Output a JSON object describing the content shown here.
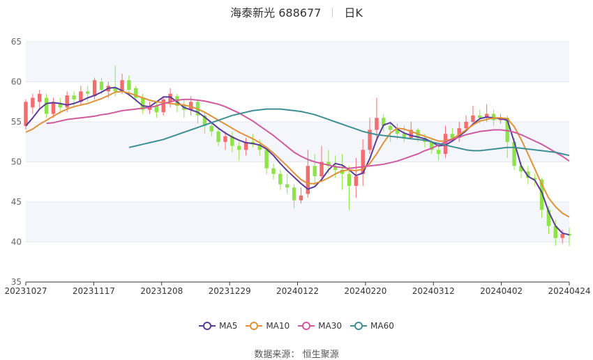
{
  "title": {
    "name": "海泰新光 688677",
    "period": "日K"
  },
  "source": {
    "label": "数据来源：",
    "value": "恒生聚源"
  },
  "colors": {
    "up": "#f26d6d",
    "down": "#8fe34a",
    "grid": "#e4e8f2",
    "band": "#f4f6fb"
  },
  "chart_data": {
    "type": "candlestick",
    "ylim": [
      35,
      65
    ],
    "yticks": [
      35,
      40,
      45,
      50,
      55,
      60,
      65
    ],
    "xticks": [
      "20231027",
      "20231117",
      "20231208",
      "20231229",
      "20240122",
      "20240220",
      "20240312",
      "20240402",
      "20240424"
    ],
    "legend_position": "bottom",
    "series": [
      {
        "name": "MA5",
        "color": "#5b3a99",
        "values": [
          54.5,
          55.5,
          56.6,
          57.3,
          57.4,
          57.3,
          57.1,
          57.3,
          57.6,
          58.0,
          58.3,
          58.7,
          59.2,
          59.3,
          58.9,
          58.4,
          57.7,
          57.0,
          56.9,
          57.5,
          58.1,
          58.1,
          57.5,
          56.8,
          56.5,
          56.2,
          55.6,
          54.9,
          54.2,
          53.6,
          53.1,
          52.7,
          52.4,
          52.3,
          52.1,
          51.6,
          50.8,
          49.8,
          48.9,
          48.1,
          47.3,
          46.6,
          46.9,
          47.8,
          49.0,
          49.8,
          49.6,
          49.0,
          48.3,
          48.6,
          50.4,
          52.8,
          54.6,
          54.9,
          54.1,
          53.6,
          53.3,
          53.1,
          52.9,
          52.5,
          52.0,
          52.1,
          52.6,
          53.2,
          53.9,
          54.7,
          55.4,
          55.6,
          55.5,
          55.4,
          55.2,
          52.5,
          49.5,
          48.2,
          47.7,
          46.2,
          43.8,
          42.0,
          41.1,
          40.9
        ]
      },
      {
        "name": "MA10",
        "color": "#e0913a",
        "values": [
          53.7,
          54.1,
          54.7,
          55.2,
          55.7,
          56.2,
          56.6,
          56.9,
          57.1,
          57.3,
          57.6,
          57.9,
          58.3,
          58.7,
          58.8,
          58.6,
          58.3,
          58.0,
          57.7,
          57.5,
          57.4,
          57.3,
          57.2,
          57.1,
          56.9,
          56.6,
          56.2,
          55.7,
          55.2,
          54.7,
          54.2,
          53.7,
          53.3,
          52.9,
          52.4,
          51.8,
          51.1,
          50.3,
          49.5,
          48.6,
          47.8,
          47.3,
          47.3,
          47.6,
          48.0,
          48.5,
          48.9,
          49.0,
          48.9,
          49.1,
          49.8,
          51.0,
          52.4,
          53.6,
          54.2,
          54.1,
          53.8,
          53.5,
          53.2,
          52.9,
          52.6,
          52.6,
          52.9,
          53.4,
          54.0,
          54.6,
          55.1,
          55.3,
          55.5,
          55.5,
          55.4,
          54.4,
          52.8,
          51.0,
          49.1,
          47.2,
          45.5,
          44.4,
          43.6,
          43.1
        ]
      },
      {
        "name": "MA30",
        "color": "#d05a9e",
        "values": [
          54.8,
          54.9,
          55.1,
          55.3,
          55.4,
          55.5,
          55.6,
          55.7,
          55.9,
          56.0,
          56.2,
          56.4,
          56.5,
          56.6,
          56.7,
          56.8,
          57.0,
          57.3,
          57.5,
          57.7,
          57.8,
          57.8,
          57.7,
          57.6,
          57.4,
          57.2,
          56.9,
          56.5,
          56.1,
          55.6,
          55.1,
          54.5,
          53.9,
          53.3,
          52.6,
          51.9,
          51.2,
          50.7,
          50.3,
          50.0,
          49.8,
          49.6,
          49.4,
          49.3,
          49.2,
          49.3,
          49.4,
          49.5,
          49.6,
          49.7,
          49.9,
          50.1,
          50.4,
          50.7,
          51.0,
          51.4,
          51.7,
          52.1,
          52.5,
          52.8,
          53.1,
          53.4,
          53.6,
          53.8,
          53.9,
          54.0,
          54.0,
          53.9,
          53.7,
          53.4,
          53.0,
          52.6,
          52.2,
          51.7,
          51.2,
          50.7,
          50.1
        ]
      },
      {
        "name": "MA60",
        "color": "#3d8f93",
        "values": [
          51.8,
          52.0,
          52.2,
          52.4,
          52.6,
          52.8,
          53.1,
          53.4,
          53.7,
          54.0,
          54.3,
          54.6,
          54.9,
          55.2,
          55.5,
          55.8,
          56.0,
          56.2,
          56.4,
          56.5,
          56.6,
          56.6,
          56.6,
          56.5,
          56.4,
          56.3,
          56.1,
          55.9,
          55.6,
          55.3,
          55.0,
          54.7,
          54.4,
          54.1,
          53.8,
          53.6,
          53.4,
          53.3,
          53.2,
          53.1,
          53.0,
          52.9,
          52.8,
          52.7,
          52.5,
          52.3,
          52.1,
          51.9,
          51.7,
          51.5,
          51.4,
          51.4,
          51.5,
          51.6,
          51.7,
          51.8,
          51.8,
          51.7,
          51.6,
          51.5,
          51.4,
          51.3,
          51.2,
          51.0,
          50.8
        ]
      },
      {
        "name": "candles",
        "values": [
          [
            54.5,
            57.5,
            54.0,
            57.8
          ],
          [
            56.8,
            58.0,
            56.0,
            58.5
          ],
          [
            57.5,
            58.5,
            56.5,
            59.0
          ],
          [
            58.0,
            56.0,
            55.5,
            58.5
          ],
          [
            56.0,
            57.5,
            55.5,
            58.0
          ],
          [
            57.3,
            56.8,
            56.0,
            58.0
          ],
          [
            56.8,
            58.3,
            56.2,
            58.8
          ],
          [
            58.3,
            57.8,
            57.0,
            58.8
          ],
          [
            57.5,
            58.8,
            57.0,
            59.5
          ],
          [
            58.8,
            58.5,
            57.5,
            59.5
          ],
          [
            58.2,
            60.2,
            57.8,
            60.5
          ],
          [
            60.0,
            59.0,
            58.5,
            60.5
          ],
          [
            58.8,
            59.5,
            58.0,
            60.0
          ],
          [
            59.2,
            58.8,
            58.2,
            62.0
          ],
          [
            58.8,
            60.2,
            58.5,
            61.0
          ],
          [
            60.2,
            59.0,
            58.2,
            60.8
          ],
          [
            59.2,
            58.0,
            57.5,
            59.5
          ],
          [
            58.0,
            56.5,
            56.0,
            58.5
          ],
          [
            56.5,
            57.0,
            56.0,
            57.5
          ],
          [
            57.0,
            56.2,
            55.5,
            57.5
          ],
          [
            56.2,
            57.8,
            55.8,
            58.2
          ],
          [
            57.5,
            58.5,
            56.8,
            59.2
          ],
          [
            58.2,
            57.0,
            56.2,
            58.5
          ],
          [
            57.2,
            56.5,
            55.5,
            57.8
          ],
          [
            56.5,
            57.5,
            55.8,
            58.2
          ],
          [
            57.5,
            55.8,
            54.8,
            57.8
          ],
          [
            55.8,
            54.5,
            53.5,
            56.2
          ],
          [
            54.5,
            53.8,
            53.2,
            55.0
          ],
          [
            53.8,
            52.5,
            52.0,
            54.2
          ],
          [
            52.5,
            53.2,
            51.5,
            53.8
          ],
          [
            53.2,
            52.0,
            51.2,
            53.8
          ],
          [
            52.0,
            51.5,
            50.2,
            52.5
          ],
          [
            51.5,
            52.5,
            50.8,
            53.0
          ],
          [
            52.5,
            52.2,
            51.8,
            53.5
          ],
          [
            52.2,
            51.5,
            50.8,
            52.8
          ],
          [
            51.5,
            49.2,
            48.5,
            51.8
          ],
          [
            49.2,
            48.5,
            47.8,
            49.8
          ],
          [
            48.5,
            47.2,
            46.5,
            49.0
          ],
          [
            47.2,
            46.8,
            46.0,
            48.5
          ],
          [
            46.8,
            45.2,
            44.2,
            47.2
          ],
          [
            45.2,
            45.8,
            44.8,
            46.8
          ],
          [
            46.0,
            49.5,
            45.5,
            51.5
          ],
          [
            49.5,
            48.2,
            47.0,
            51.0
          ],
          [
            48.2,
            50.0,
            47.5,
            52.0
          ],
          [
            50.0,
            49.5,
            48.5,
            51.5
          ],
          [
            49.5,
            49.0,
            48.0,
            50.8
          ],
          [
            49.0,
            48.5,
            46.5,
            51.0
          ],
          [
            48.5,
            47.0,
            44.0,
            49.5
          ],
          [
            47.0,
            48.2,
            45.5,
            50.5
          ],
          [
            48.5,
            51.5,
            47.0,
            52.8
          ],
          [
            51.5,
            54.0,
            51.0,
            55.5
          ],
          [
            54.0,
            55.5,
            53.0,
            58.0
          ],
          [
            55.5,
            54.5,
            53.8,
            56.0
          ],
          [
            54.5,
            54.0,
            52.5,
            55.0
          ],
          [
            54.0,
            53.5,
            52.8,
            54.8
          ],
          [
            53.5,
            53.0,
            52.5,
            54.5
          ],
          [
            53.0,
            54.0,
            52.8,
            55.0
          ],
          [
            54.0,
            53.0,
            52.5,
            54.2
          ],
          [
            53.0,
            52.5,
            51.8,
            53.5
          ],
          [
            52.5,
            51.5,
            51.0,
            53.0
          ],
          [
            51.5,
            51.0,
            50.2,
            52.0
          ],
          [
            51.0,
            53.5,
            50.5,
            54.5
          ],
          [
            53.5,
            53.0,
            52.5,
            54.2
          ],
          [
            53.0,
            54.2,
            52.5,
            55.0
          ],
          [
            54.2,
            55.0,
            53.8,
            55.8
          ],
          [
            55.0,
            55.8,
            54.5,
            57.0
          ],
          [
            55.8,
            55.5,
            54.8,
            56.5
          ],
          [
            55.5,
            56.0,
            55.0,
            57.2
          ],
          [
            56.0,
            55.2,
            54.5,
            56.5
          ],
          [
            55.2,
            55.5,
            54.8,
            56.0
          ],
          [
            55.5,
            52.5,
            50.5,
            55.8
          ],
          [
            52.5,
            49.5,
            49.0,
            53.0
          ],
          [
            49.5,
            48.8,
            48.0,
            50.0
          ],
          [
            48.8,
            48.0,
            47.2,
            49.5
          ],
          [
            48.0,
            47.8,
            47.0,
            48.5
          ],
          [
            47.8,
            44.0,
            43.0,
            48.0
          ],
          [
            44.0,
            42.0,
            41.0,
            44.5
          ],
          [
            42.0,
            40.5,
            39.5,
            42.8
          ],
          [
            40.5,
            41.0,
            39.8,
            41.5
          ],
          [
            41.0,
            40.8,
            39.5,
            41.8
          ]
        ]
      }
    ]
  }
}
